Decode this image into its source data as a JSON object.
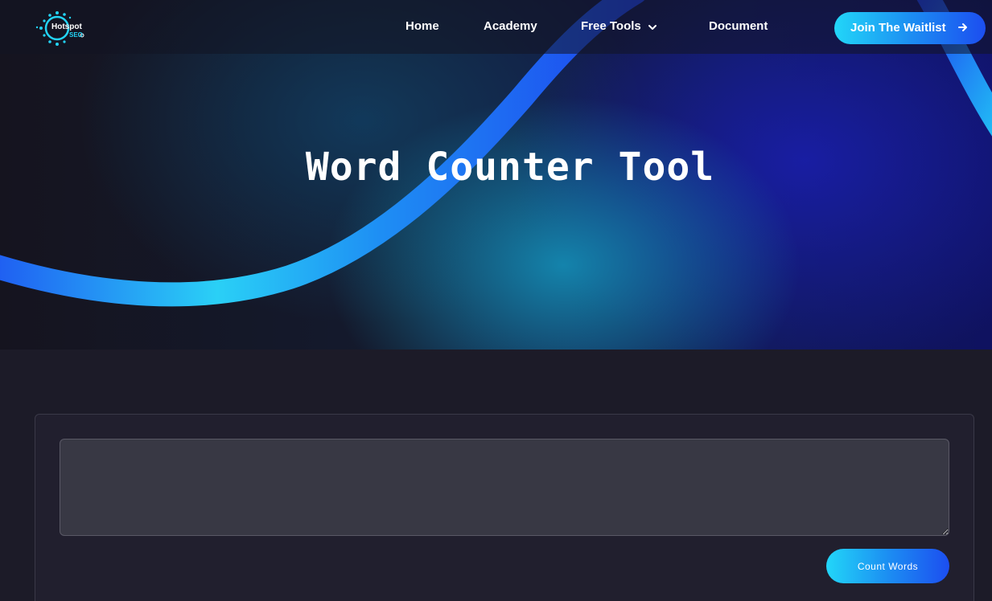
{
  "brand": {
    "name_line1": "Hotspot",
    "name_line2": "SEO",
    "accent_color": "#23d3f5",
    "logo_icon": "hotspot-dots-logo-icon"
  },
  "nav": {
    "items": [
      {
        "label": "Home"
      },
      {
        "label": "Academy"
      },
      {
        "label": "Free Tools",
        "icon": "chevron-down-icon"
      },
      {
        "label": "Document"
      }
    ],
    "cta": {
      "label": "Join The Waitlist",
      "icon": "arrow-right-icon"
    }
  },
  "hero": {
    "title": "Word Counter Tool"
  },
  "tool": {
    "textarea_value": "",
    "button_label": "Count Words"
  },
  "colors": {
    "page_bg": "#1c1b28",
    "card_bg": "#211f2e",
    "textarea_bg": "#383844",
    "gradient_start": "#22d6f8",
    "gradient_end": "#1c4ef0"
  }
}
